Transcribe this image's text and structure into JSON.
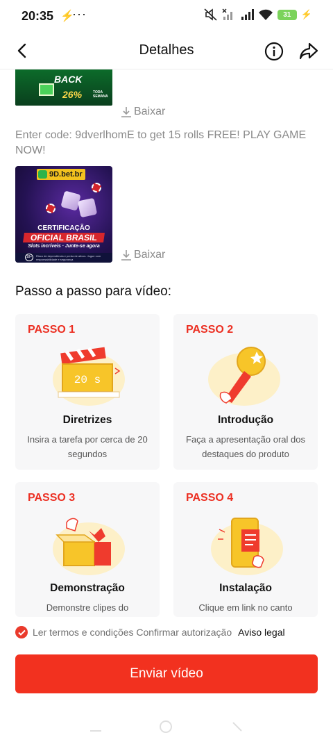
{
  "status_bar": {
    "time": "20:35",
    "battery": "31"
  },
  "header": {
    "title": "Detalhes"
  },
  "banner_cashback": {
    "word": "BACK",
    "percent": "26%",
    "tag_line1": "TODA",
    "tag_line2": "SEMANA"
  },
  "downloads": {
    "label": "Baixar"
  },
  "promo": {
    "text": "Enter code: 9dverlhomE to get 15 rolls FREE! PLAY GAME NOW!"
  },
  "banner_9d": {
    "logo": "9D.bet.br",
    "cert": "CERTIFICAÇÃO",
    "oficial": "OFICIAL BRASIL",
    "slots": "Slots incríveis · Junte-se agora",
    "age": "18+",
    "fine_print": "Risco de dependência e perda de ativos. Jogue com responsabilidade e segurança"
  },
  "steps_section": {
    "title": "Passo a passo para vídeo:"
  },
  "steps": [
    {
      "label": "PASSO 1",
      "name": "Diretrizes",
      "desc": "Insira a tarefa por cerca de 20 segundos",
      "timer": "20 s"
    },
    {
      "label": "PASSO 2",
      "name": "Introdução",
      "desc": "Faça a apresentação oral dos destaques do produto"
    },
    {
      "label": "PASSO 3",
      "name": "Demonstração",
      "desc": "Demonstre clipes do"
    },
    {
      "label": "PASSO 4",
      "name": "Instalação",
      "desc": "Clique em link no canto"
    }
  ],
  "terms": {
    "text": "Ler termos e condições Confirmar autorização",
    "legal": "Aviso legal",
    "checked": true
  },
  "submit": {
    "label": "Enviar vídeo"
  },
  "colors": {
    "accent": "#f2311f",
    "step_label": "#ec2f22",
    "card_bg": "#f7f7f8"
  }
}
